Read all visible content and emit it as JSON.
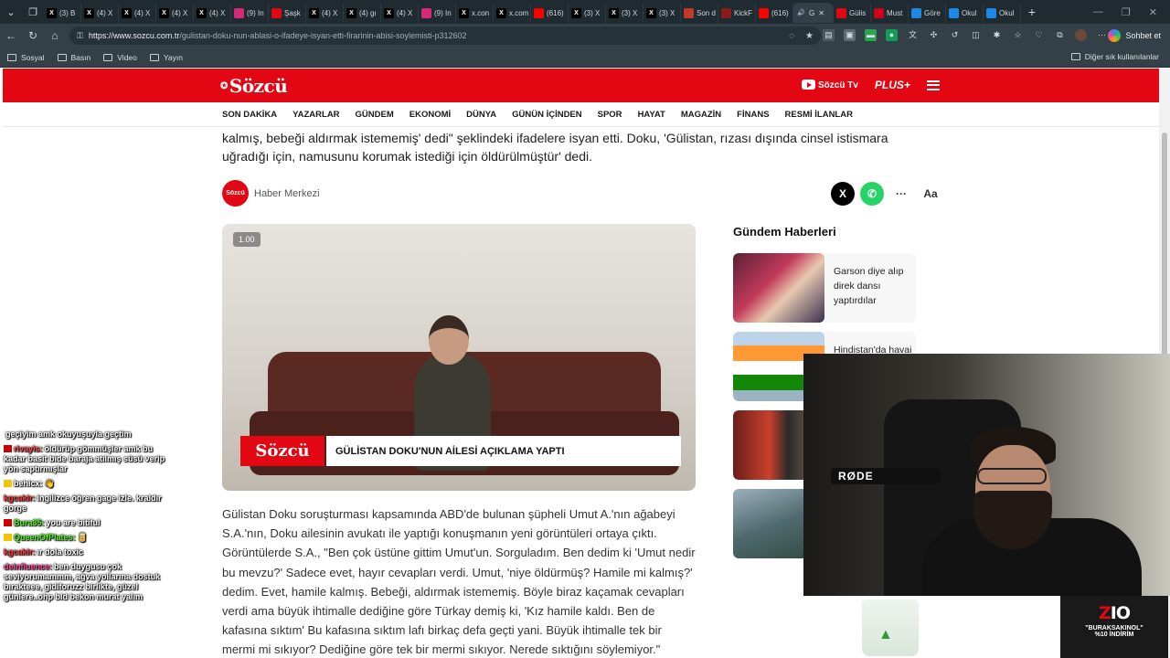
{
  "browser": {
    "tabs": [
      {
        "label": "(3) B",
        "icon": "x-icon",
        "color": "#000000"
      },
      {
        "label": "(4) X",
        "icon": "x-icon",
        "color": "#000000"
      },
      {
        "label": "(4) X",
        "icon": "x-icon",
        "color": "#000000"
      },
      {
        "label": "(4) X",
        "icon": "x-icon",
        "color": "#000000"
      },
      {
        "label": "(4) X",
        "icon": "x-icon",
        "color": "#000000"
      },
      {
        "label": "(9) In",
        "icon": "instagram-icon",
        "color": "#d62976"
      },
      {
        "label": "Şaşk",
        "icon": "sozcu-icon",
        "color": "#e30613"
      },
      {
        "label": "(4) X",
        "icon": "x-icon",
        "color": "#000000"
      },
      {
        "label": "(4) gı",
        "icon": "x-icon",
        "color": "#000000"
      },
      {
        "label": "(4) X",
        "icon": "x-icon",
        "color": "#000000"
      },
      {
        "label": "(9) In",
        "icon": "instagram-icon",
        "color": "#d62976"
      },
      {
        "label": "x.con",
        "icon": "x-icon",
        "color": "#000000"
      },
      {
        "label": "x.com",
        "icon": "x-icon",
        "color": "#000000"
      },
      {
        "label": "(616)",
        "icon": "youtube-icon",
        "color": "#ff0000"
      },
      {
        "label": "(3) X",
        "icon": "x-icon",
        "color": "#000000"
      },
      {
        "label": "(3) X",
        "icon": "x-icon",
        "color": "#000000"
      },
      {
        "label": "(3) X",
        "icon": "x-icon",
        "color": "#000000"
      },
      {
        "label": "Son d",
        "icon": "news-icon",
        "color": "#c0392b"
      },
      {
        "label": "KickF",
        "icon": "kick-icon",
        "color": "#8b1a1a"
      },
      {
        "label": "(616)",
        "icon": "youtube-icon",
        "color": "#ff0000"
      },
      {
        "label": "G",
        "icon": "speaker-icon",
        "color": "#334047",
        "active": true
      },
      {
        "label": "Gülis",
        "icon": "sozcu-icon",
        "color": "#e30613"
      },
      {
        "label": "Must",
        "icon": "news-icon",
        "color": "#d0021b"
      },
      {
        "label": "Göre",
        "icon": "edge-icon",
        "color": "#1e88e5"
      },
      {
        "label": "Okul",
        "icon": "edge-icon",
        "color": "#1e88e5"
      },
      {
        "label": "Okul",
        "icon": "edge-icon",
        "color": "#1e88e5"
      }
    ],
    "url_host": "https://www.sozcu.com.tr",
    "url_path": "/gulistan-doku-nun-ablasi-o-ifadeye-isyan-etti-firarinin-abisi-soylemisti-p312602",
    "sidebar_button": "Sohbet et",
    "bookmarks": [
      "Sosyal",
      "Basın",
      "Video",
      "Yayın"
    ],
    "other_bookmarks": "Diğer sık kullanılanlar"
  },
  "site": {
    "logo": "Sözcü",
    "header_links": {
      "tv": "Sözcü Tv",
      "plus": "PLUS+"
    },
    "nav": [
      "SON DAKİKA",
      "YAZARLAR",
      "GÜNDEM",
      "EKONOMİ",
      "DÜNYA",
      "GÜNÜN İÇİNDEN",
      "SPOR",
      "HAYAT",
      "MAGAZİN",
      "FİNANS",
      "RESMİ İLANLAR"
    ],
    "lead_text": "kalmış, bebeği aldırmak istememiş' dedi\" şeklindeki ifadelere isyan etti. Doku, 'Gülistan, rızası dışında cinsel istismara uğradığı için, namusunu korumak istediği için öldürülmüştür' dedi.",
    "author": {
      "avatar_text": "Sözcü",
      "name": "Haber Merkezi"
    },
    "share": {
      "x": "X",
      "more": "···",
      "font": "Aa"
    },
    "video": {
      "speed_badge": "1.00",
      "brand": "Sözcü",
      "caption": "GÜLİSTAN DOKU'NUN AİLESİ AÇIKLAMA YAPTI"
    },
    "body_text": "Gülistan Doku soruşturması kapsamında ABD'de bulunan şüpheli Umut A.'nın ağabeyi S.A.'nın, Doku ailesinin avukatı ile yaptığı konuşmanın yeni görüntüleri ortaya çıktı. Görüntülerde S.A., \"Ben çok üstüne gittim Umut'un. Sorguladım. Ben dedim ki 'Umut nedir bu mevzu?' Sadece evet, hayır cevapları verdi. Umut, 'niye öldürmüş? Hamile mi kalmış?' dedim. Evet, hamile kalmış. Bebeği, aldırmak istememiş. Böyle biraz kaçamak cevapları verdi ama büyük ihtimalle dediğine göre Türkay demiş ki, 'Kız hamile kaldı. Ben de kafasına sıktım' Bu kafasına sıktım lafı birkaç defa geçti yani. Büyük ihtimalle tek bir mermi mi sıkıyor? Dediğine göre tek bir mermi sıkıyor. Nerede sıktığını söylemiyor.\"",
    "sidebar_title": "Gündem Haberleri",
    "sidebar_news": [
      {
        "title": "Garson diye alıp direk dansı yaptırdılar"
      },
      {
        "title": "Hindistan'da havai"
      },
      {
        "title": ""
      },
      {
        "title": ""
      }
    ]
  },
  "chat": [
    {
      "user": "",
      "text": "geçiyim amk okuyuşuyla geçtim",
      "color": "#ffffff",
      "badge": ""
    },
    {
      "user": "rivayis:",
      "text": "öldürüp gömmüşler amk bu kadar basit bide baraja atılmış süsü verip yön saptırmışlar",
      "color": "#ff4d4d",
      "badge": "#cc0000"
    },
    {
      "user": "behicx:",
      "text": "👋",
      "color": "#ffffff",
      "badge": "#f5c400"
    },
    {
      "user": "kgcakir:",
      "text": "ingilizce öğren gage izle. kraldır gorge",
      "color": "#ff3b3b",
      "badge": ""
    },
    {
      "user": "Bura35:",
      "text": "you are bitiful",
      "color": "#53fc18",
      "badge": "#cc0000"
    },
    {
      "user": "QueenOfPlates:",
      "text": "🥫",
      "color": "#53fc18",
      "badge": "#f5c400"
    },
    {
      "user": "kgcakir:",
      "text": "ır dola toxic",
      "color": "#ff3b3b",
      "badge": ""
    },
    {
      "user": "deinfluence:",
      "text": "ben duygusu çok seviyorumammm, ağva yollarına dostuk bırakteee, gidiforuzz birlikte, güzel günlere..ohp bld bekon murat yalım",
      "color": "#ff4d9a",
      "badge": ""
    }
  ],
  "webcam": {
    "mic_brand": "RØDE"
  },
  "promo": {
    "logo_z": "Z",
    "logo_rest": "IO",
    "code": "\"BURAKSAKINOL\"",
    "discount": "%10 İNDİRİM"
  },
  "colors": {
    "sozcu_red": "#e30613",
    "chrome_dark": "#1f2b31",
    "chrome": "#334047"
  }
}
